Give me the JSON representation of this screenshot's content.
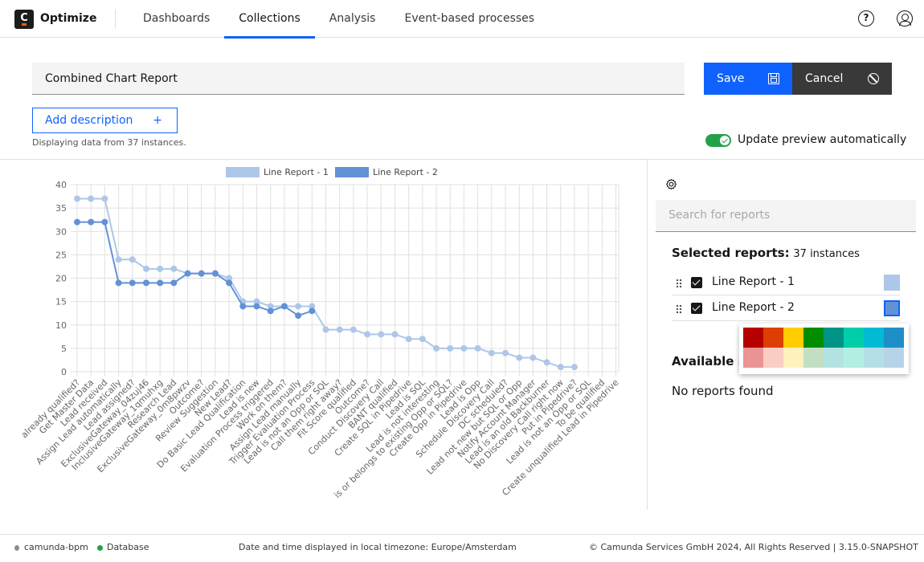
{
  "app": {
    "name": "Optimize",
    "logo_letter": "C"
  },
  "nav": {
    "items": [
      {
        "label": "Dashboards",
        "active": false
      },
      {
        "label": "Collections",
        "active": true
      },
      {
        "label": "Analysis",
        "active": false
      },
      {
        "label": "Event-based processes",
        "active": false
      }
    ],
    "help_icon": "?",
    "user_icon": "user-icon"
  },
  "report": {
    "name": "Combined Chart Report",
    "save_label": "Save",
    "cancel_label": "Cancel",
    "add_description_label": "Add description",
    "add_description_icon": "+",
    "instances_note": "Displaying data from 37 instances.",
    "auto_update_label": "Update preview automatically",
    "auto_update_on": true
  },
  "panel": {
    "search_placeholder": "Search for reports",
    "selected_title": "Selected reports:",
    "selected_count": "37 instances",
    "selected_reports": [
      {
        "label": "Line Report - 1",
        "checked": true,
        "color": "#aec7e8"
      },
      {
        "label": "Line Report - 2",
        "checked": true,
        "color": "#6391d6"
      }
    ],
    "available_title": "Available reports",
    "no_reports": "No reports found",
    "palette": [
      "#b60000",
      "#dc3f00",
      "#ffcd00",
      "#008e00",
      "#009486",
      "#00cea8",
      "#00bbd3",
      "#1c8fc7",
      "#ea9494",
      "#fbcec3",
      "#fff2bc",
      "#c3dfc3",
      "#b3e3e0",
      "#b3eee2",
      "#b5dfe6",
      "#b6d4e8"
    ]
  },
  "footer": {
    "engine": "camunda-bpm",
    "database": "Database",
    "timezone": "Date and time displayed in local timezone: Europe/Amsterdam",
    "copyright": "© Camunda Services GmbH 2024, All Rights Reserved | 3.15.0-SNAPSHOT"
  },
  "chart_data": {
    "type": "line",
    "title": "",
    "xlabel": "",
    "ylabel": "",
    "ylim": [
      0,
      40
    ],
    "yticks": [
      0,
      5,
      10,
      15,
      20,
      25,
      30,
      35,
      40
    ],
    "grid": true,
    "legend": "top-center",
    "categories": [
      "already qualified?",
      "Get Master Data",
      "Lead received",
      "Assign Lead automatically",
      "Lead assigned?",
      "ExclusiveGateway_04zuj46",
      "InclusiveGateway_1qmuhxg",
      "Research Lead",
      "ExclusiveGateway_0m8pwzv",
      "Outcome?",
      "Review Suggestion",
      "New Lead?",
      "Do Basic Lead Qualification",
      "Lead is new",
      "Evaluation Process triggered",
      "Work on them?",
      "Assign Lead manually",
      "Trigger Evaluation Process",
      "Lead is not an Opp or SQL",
      "Call them right away?",
      "Fit Score qualified",
      "Outcome?",
      "Conduct Discovery Call",
      "BANT qualified",
      "Create SQL in Pipedrive",
      "Lead is SQL",
      "Lead is not interesting",
      "is or belongs to existing Opp or SQL?",
      "Create Opp in Pipedrive",
      "Lead is Opp",
      "Schedule Discovery Call",
      "DC scheduled?",
      "Lead not new but SQL or Opp",
      "Notify Account Manager",
      "Lead is an old Backburner",
      "No Discovery Call right now",
      "Put in Pipedrive?",
      "Lead is not an Opp or SQL",
      "To be qualified",
      "Create unqualified Lead in Pipedrive"
    ],
    "series": [
      {
        "name": "Line Report - 1",
        "color": "#aec7e8",
        "values": [
          37,
          37,
          37,
          24,
          24,
          22,
          22,
          22,
          21,
          21,
          21,
          20,
          15,
          15,
          14,
          14,
          14,
          14,
          9,
          9,
          9,
          8,
          8,
          8,
          7,
          7,
          5,
          5,
          5,
          5,
          4,
          4,
          3,
          3,
          2,
          1,
          1,
          null,
          null,
          null
        ]
      },
      {
        "name": "Line Report - 2",
        "color": "#6391d6",
        "values": [
          32,
          32,
          32,
          19,
          19,
          19,
          19,
          19,
          21,
          21,
          21,
          19,
          14,
          14,
          13,
          14,
          12,
          13,
          null,
          null,
          null,
          null,
          null,
          null,
          null,
          null,
          null,
          null,
          null,
          null,
          null,
          null,
          null,
          null,
          null,
          null,
          null,
          null,
          null,
          null
        ]
      }
    ]
  }
}
